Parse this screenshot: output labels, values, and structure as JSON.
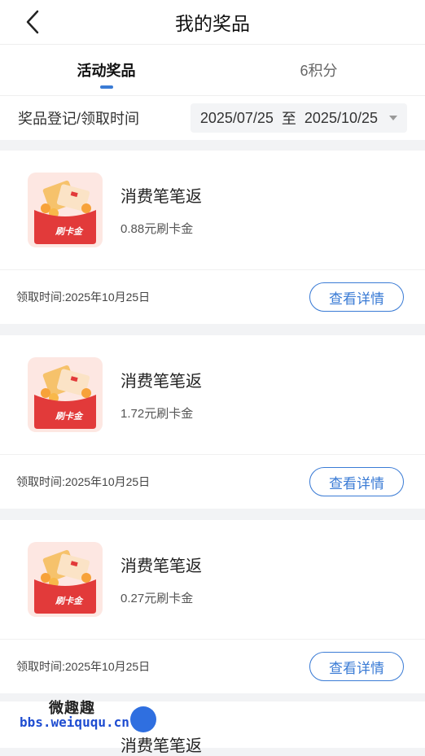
{
  "header": {
    "title": "我的奖品"
  },
  "tabs": [
    {
      "label": "活动奖品"
    },
    {
      "label": "6积分"
    }
  ],
  "filter": {
    "label": "奖品登记/领取时间",
    "start": "2025/07/25",
    "sep": "至",
    "end": "2025/10/25"
  },
  "prizes": [
    {
      "name": "消费笔笔返",
      "amount": "0.88元刷卡金",
      "time": "领取时间:2025年10月25日",
      "button": "查看详情",
      "badge": "刷卡金"
    },
    {
      "name": "消费笔笔返",
      "amount": "1.72元刷卡金",
      "time": "领取时间:2025年10月25日",
      "button": "查看详情",
      "badge": "刷卡金"
    },
    {
      "name": "消费笔笔返",
      "amount": "0.27元刷卡金",
      "time": "领取时间:2025年10月25日",
      "button": "查看详情",
      "badge": "刷卡金"
    }
  ],
  "partial_prize": {
    "name": "消费笔笔返"
  },
  "watermark": {
    "line1": "微趣趣",
    "line2": "bbs.weiququ.cn"
  },
  "colors": {
    "accent": "#3a7bd5",
    "envelope": "#e23a3a"
  }
}
